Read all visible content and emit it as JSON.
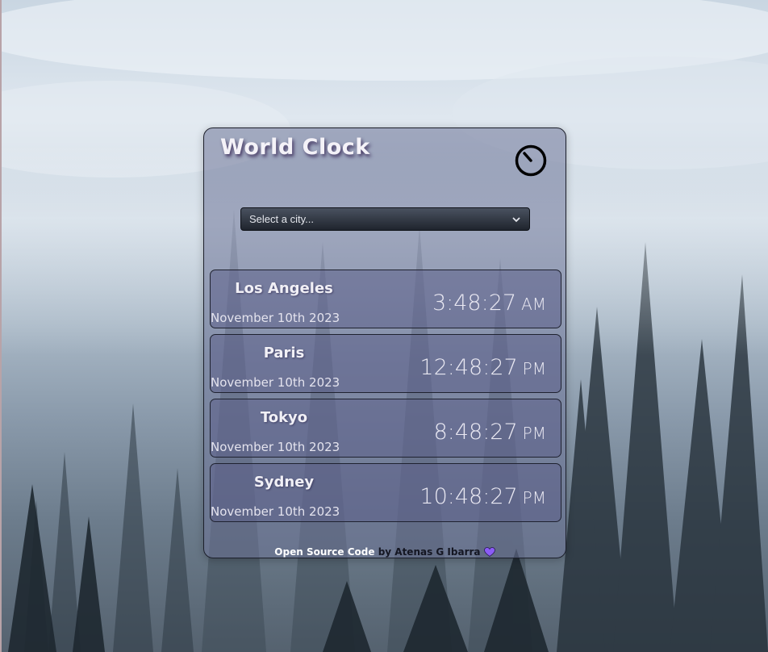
{
  "app": {
    "title": "World Clock"
  },
  "selector": {
    "placeholder": "Select a city..."
  },
  "cities": [
    {
      "name": "Los Angeles",
      "date": "November 10th 2023",
      "time": "3:48:27",
      "ampm": "AM"
    },
    {
      "name": "Paris",
      "date": "November 10th 2023",
      "time": "12:48:27",
      "ampm": "PM"
    },
    {
      "name": "Tokyo",
      "date": "November 10th 2023",
      "time": "8:48:27",
      "ampm": "PM"
    },
    {
      "name": "Sydney",
      "date": "November 10th 2023",
      "time": "10:48:27",
      "ampm": "PM"
    }
  ],
  "footer": {
    "link_text": "Open Source Code",
    "by_text": " by Atenas G Ibarra "
  },
  "colors": {
    "heart": "#8b5cf6",
    "card_border": "#1c1f2b"
  },
  "icons": [
    "clock-icon",
    "chevron-down-icon",
    "heart-icon"
  ]
}
